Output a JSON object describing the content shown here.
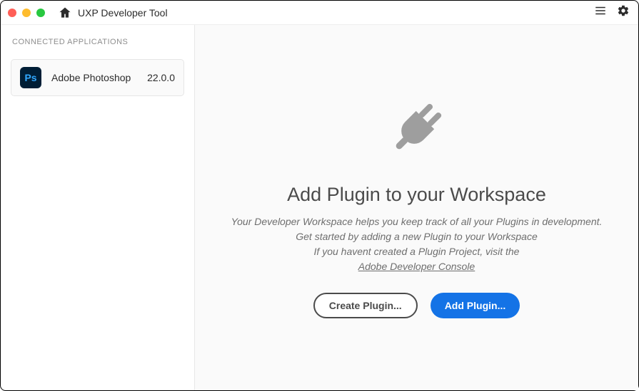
{
  "titlebar": {
    "title": "UXP Developer Tool"
  },
  "sidebar": {
    "header": "CONNECTED APPLICATIONS",
    "apps": [
      {
        "icon": "Ps",
        "name": "Adobe Photoshop",
        "version": "22.0.0"
      }
    ]
  },
  "content": {
    "headline": "Add Plugin to your Workspace",
    "line1": "Your Developer Workspace helps you keep track of all your Plugins in development.",
    "line2": "Get started by adding a new Plugin to your Workspace",
    "line3_prefix": "If you havent created a Plugin Project, visit the",
    "link": "Adobe Developer Console",
    "create_label": "Create Plugin...",
    "add_label": "Add Plugin..."
  }
}
